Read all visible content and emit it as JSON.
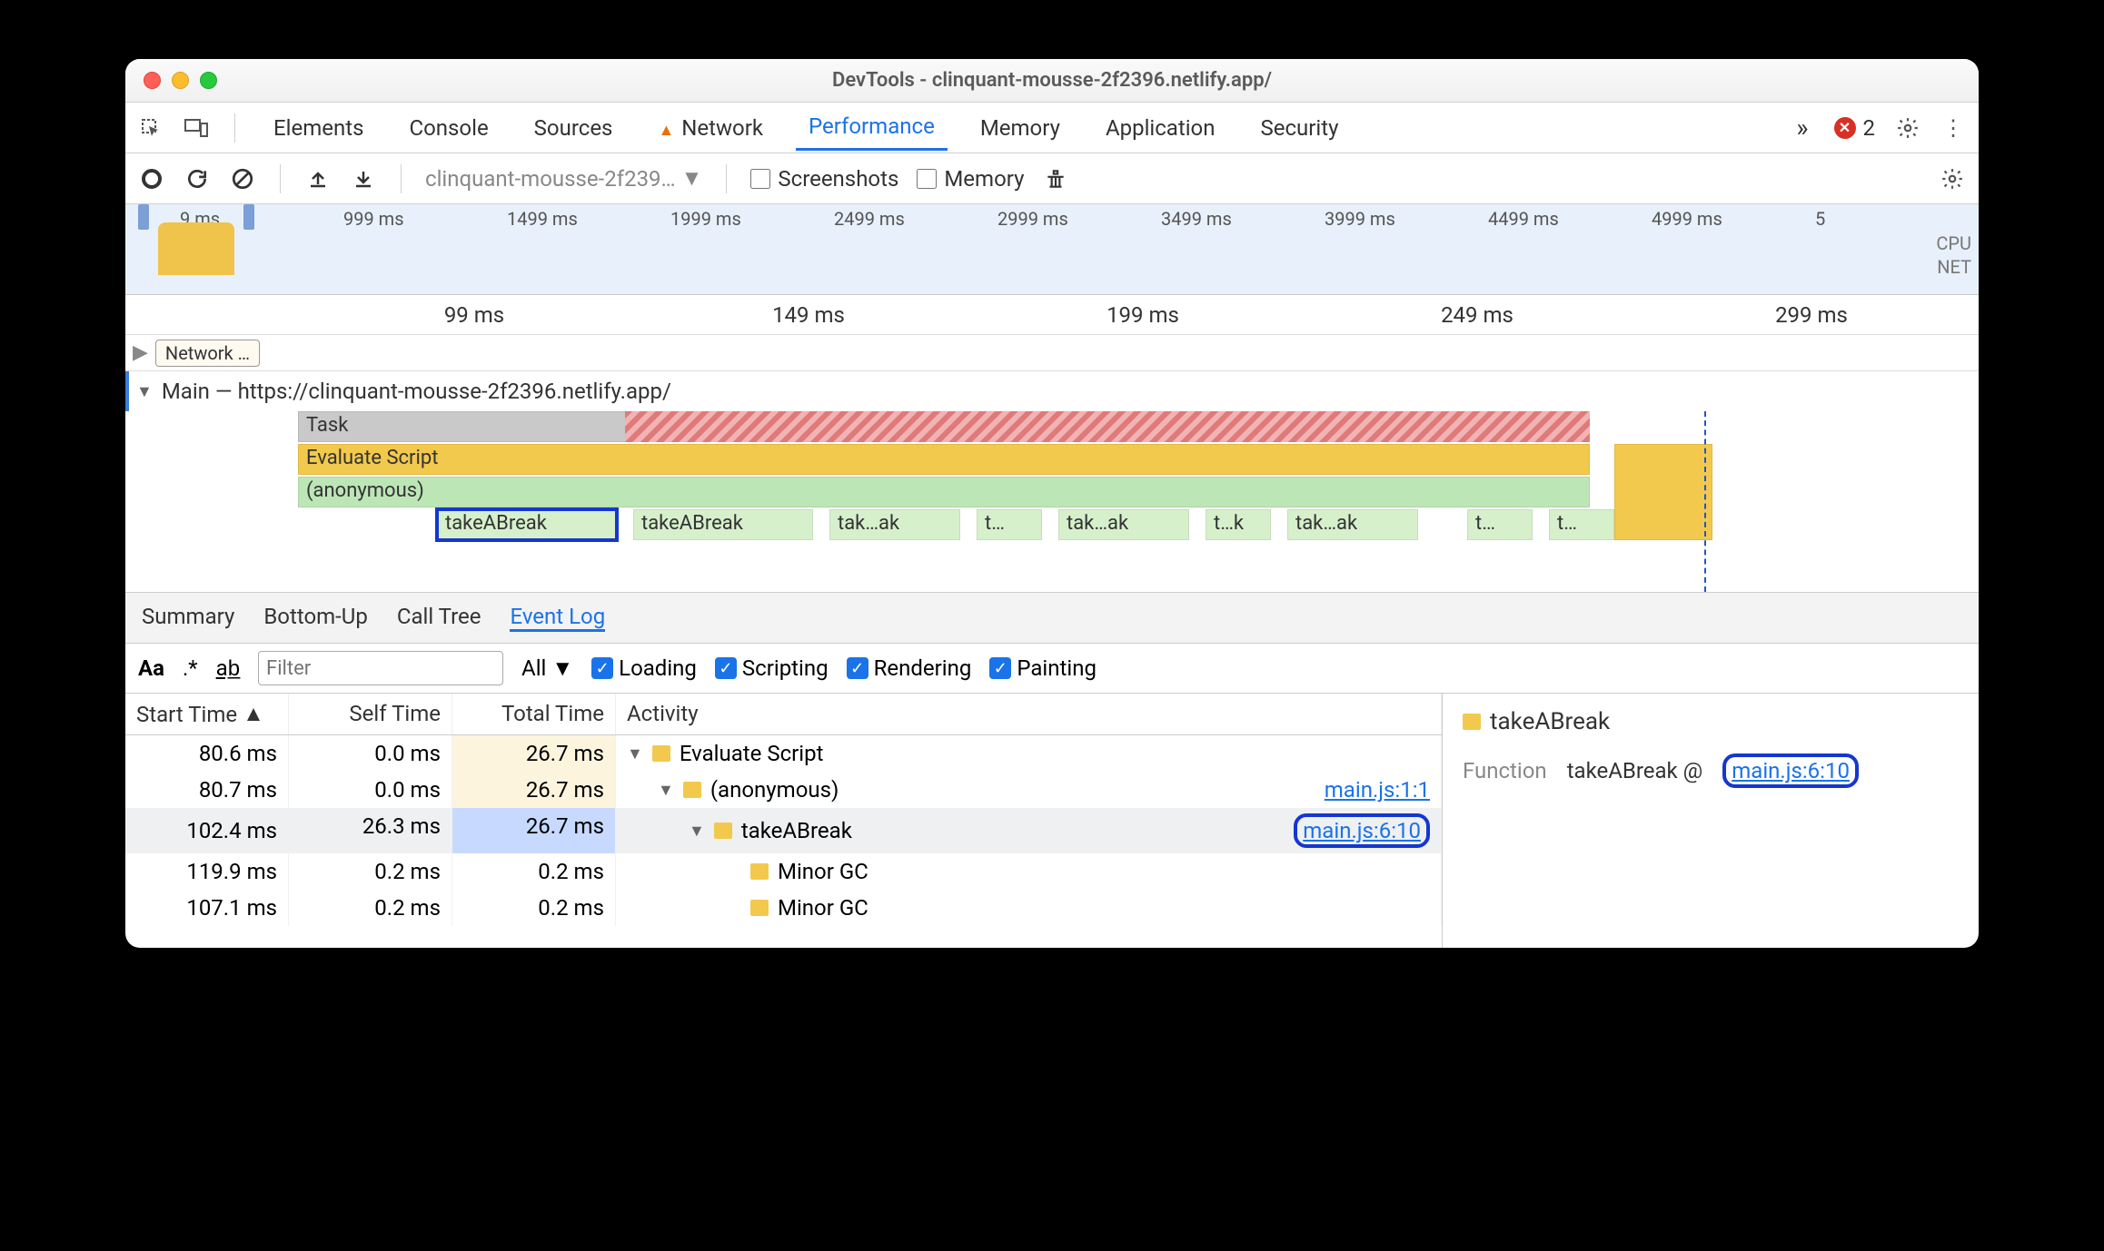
{
  "window": {
    "title": "DevTools - clinquant-mousse-2f2396.netlify.app/"
  },
  "tabs": {
    "items": [
      "Elements",
      "Console",
      "Sources",
      "Network",
      "Performance",
      "Memory",
      "Application",
      "Security"
    ],
    "active": "Performance",
    "overflow": "»",
    "errorCount": "2"
  },
  "toolbar2": {
    "profileDropdown": "clinquant-mousse-2f239…",
    "screenshots": "Screenshots",
    "memory": "Memory"
  },
  "overview": {
    "ticks": [
      "9 ms",
      "999 ms",
      "1499 ms",
      "1999 ms",
      "2499 ms",
      "2999 ms",
      "3499 ms",
      "3999 ms",
      "4499 ms",
      "4999 ms",
      "5"
    ],
    "rightLabels": [
      "CPU",
      "NET"
    ]
  },
  "axis2": {
    "ticks": [
      "99 ms",
      "149 ms",
      "199 ms",
      "249 ms",
      "299 ms"
    ]
  },
  "network": {
    "label": "Network …"
  },
  "mainThread": {
    "title": "Main — https://clinquant-mousse-2f2396.netlify.app/",
    "rows": {
      "task": "Task",
      "evalScript": "Evaluate Script",
      "anon": "(anonymous)",
      "calls": [
        "takeABreak",
        "takeABreak",
        "tak…ak",
        "t…",
        "tak…ak",
        "t…k",
        "tak…ak",
        "t…",
        "t…"
      ]
    }
  },
  "bottomTabs": {
    "items": [
      "Summary",
      "Bottom-Up",
      "Call Tree",
      "Event Log"
    ],
    "active": "Event Log"
  },
  "filters": {
    "aa": "Aa",
    "regex": ".*",
    "ab": "ab̲",
    "placeholder": "Filter",
    "levelSel": "All",
    "checks": [
      "Loading",
      "Scripting",
      "Rendering",
      "Painting"
    ]
  },
  "tableHeaders": {
    "start": "Start Time",
    "self": "Self Time",
    "total": "Total Time",
    "activity": "Activity"
  },
  "rows": [
    {
      "start": "80.6 ms",
      "self": "0.0 ms",
      "total": "26.7 ms",
      "indent": 0,
      "expander": "▼",
      "label": "Evaluate Script",
      "link": "",
      "totcls": "hl1"
    },
    {
      "start": "80.7 ms",
      "self": "0.0 ms",
      "total": "26.7 ms",
      "indent": 1,
      "expander": "▼",
      "label": "(anonymous)",
      "link": "main.js:1:1",
      "totcls": "hl1"
    },
    {
      "start": "102.4 ms",
      "self": "26.3 ms",
      "total": "26.7 ms",
      "indent": 2,
      "expander": "▼",
      "label": "takeABreak",
      "link": "main.js:6:10",
      "totcls": "hl2",
      "sel": true,
      "linkboxed": true
    },
    {
      "start": "119.9 ms",
      "self": "0.2 ms",
      "total": "0.2 ms",
      "indent": 3,
      "expander": "",
      "label": "Minor GC",
      "link": "",
      "totcls": ""
    },
    {
      "start": "107.1 ms",
      "self": "0.2 ms",
      "total": "0.2 ms",
      "indent": 3,
      "expander": "",
      "label": "Minor GC",
      "link": "",
      "totcls": ""
    }
  ],
  "side": {
    "title": "takeABreak",
    "kind": "Function",
    "funcName": "takeABreak @",
    "funcLink": "main.js:6:10"
  }
}
